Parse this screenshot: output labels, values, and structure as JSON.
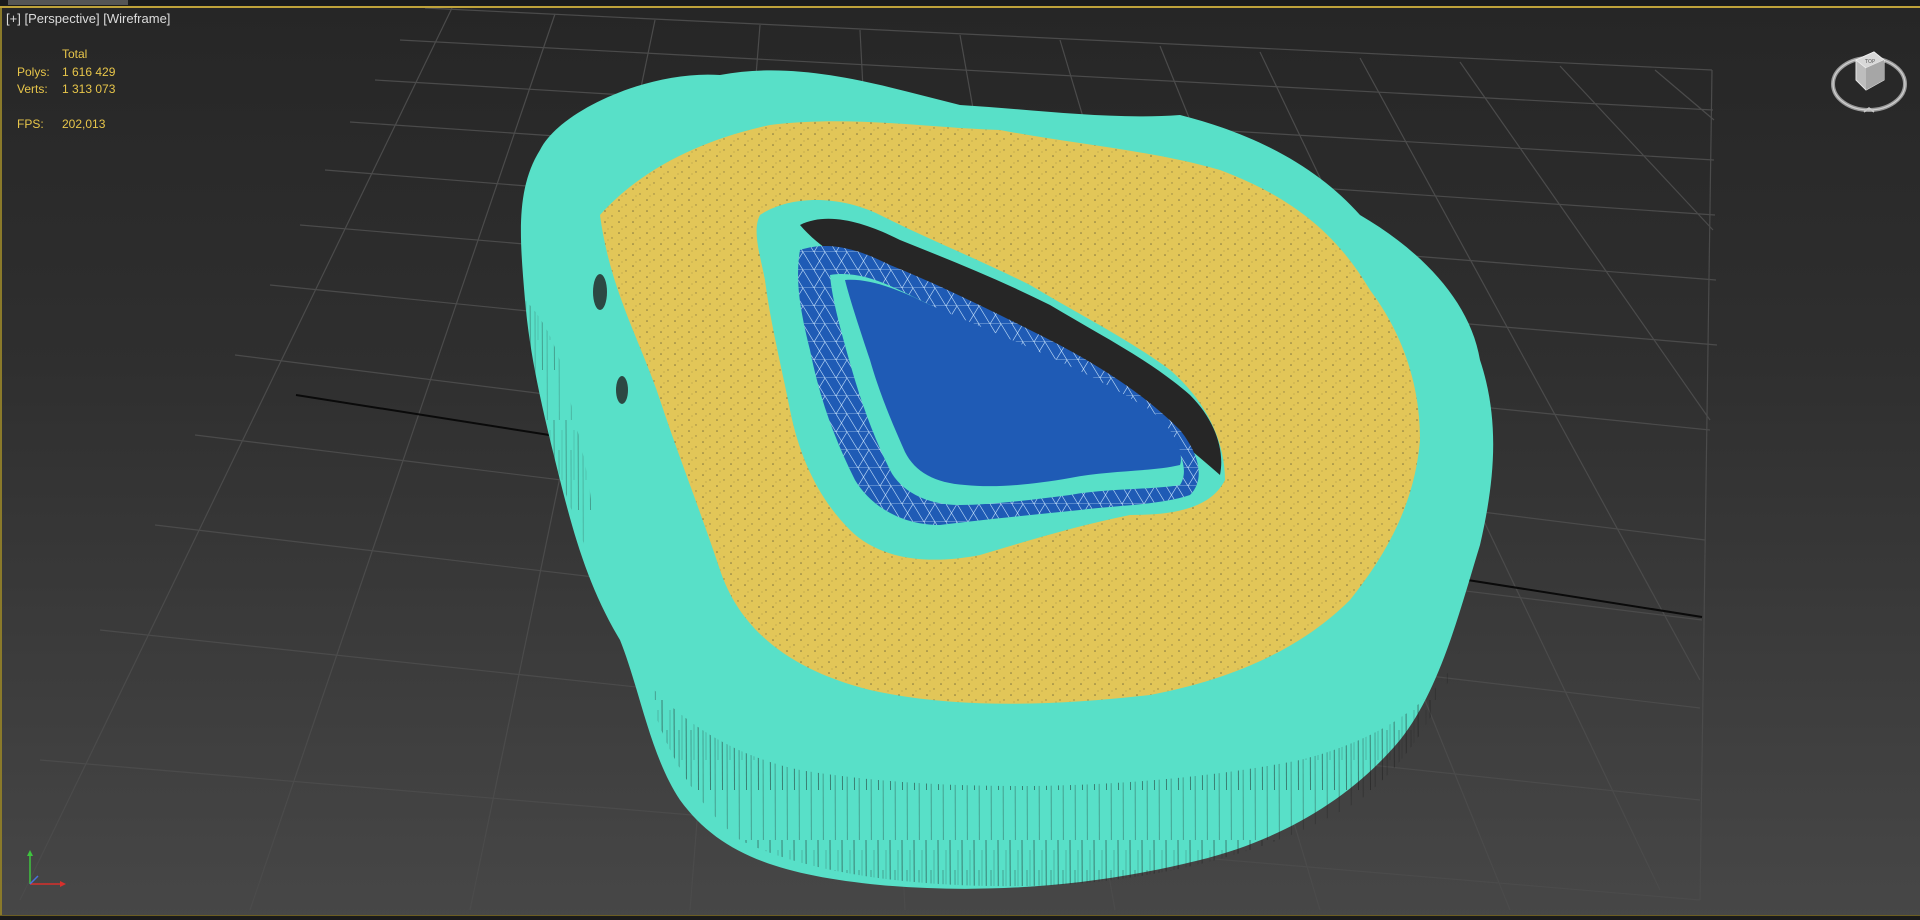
{
  "viewport": {
    "label_plus": "[+]",
    "label_view": "[Perspective]",
    "label_shading": "[Wireframe]"
  },
  "stats": {
    "header": "Total",
    "polys_label": "Polys:",
    "polys_value": "1 616 429",
    "verts_label": "Verts:",
    "verts_value": "1 313 073",
    "fps_label": "FPS:",
    "fps_value": "202,013"
  },
  "viewcube": {
    "face_label": "TOP"
  },
  "colors": {
    "accent": "#e8c64a",
    "mesh_outer": "#58e0c8",
    "mesh_sand": "#e2c658",
    "mesh_water": "#1f5bb5",
    "grid": "#4a4a4a"
  },
  "icons": {
    "viewcube": "viewcube-icon",
    "axis": "axis-tripod-icon"
  }
}
